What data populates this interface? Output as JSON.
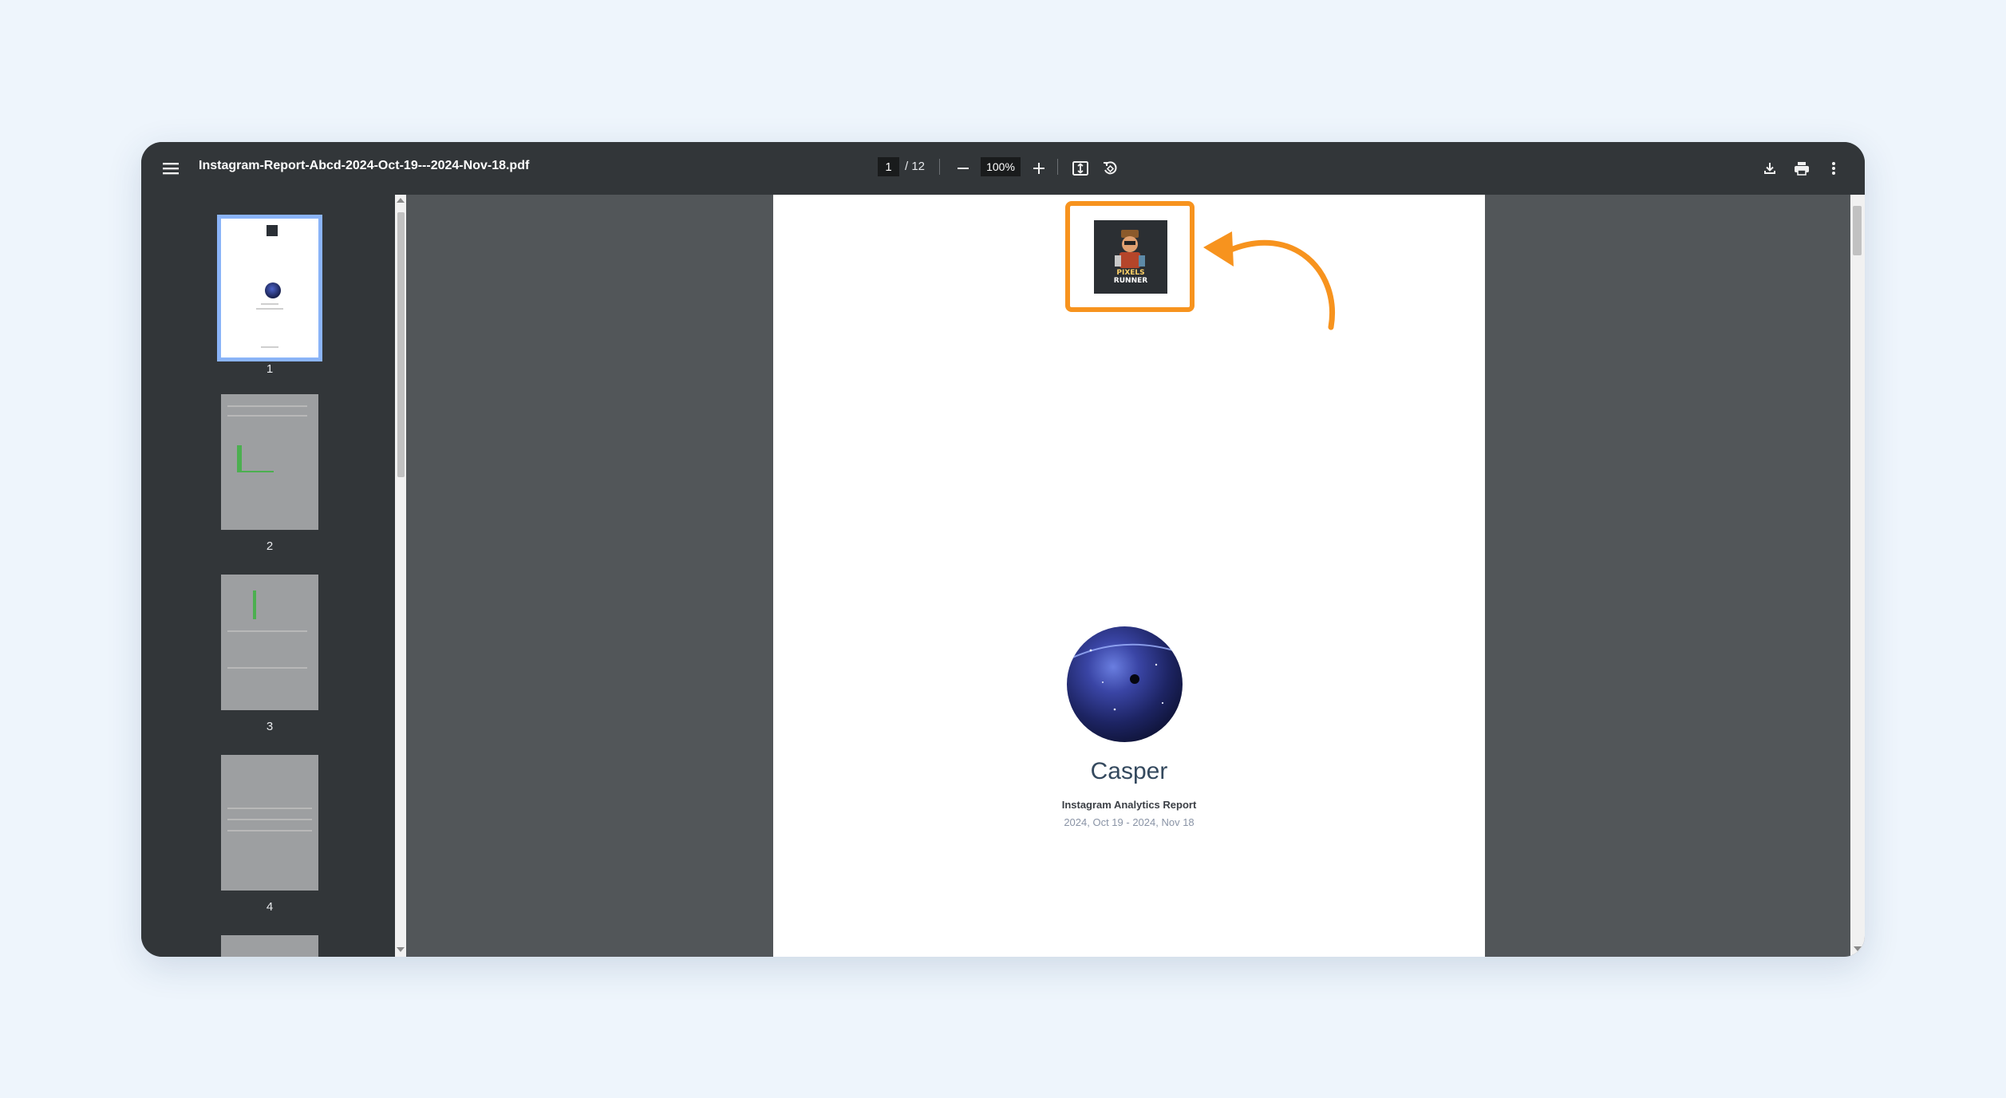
{
  "toolbar": {
    "menu_icon": "hamburger-menu-icon",
    "file_name": "Instagram-Report-Abcd-2024-Oct-19---2024-Nov-18.pdf",
    "current_page": "1",
    "total_pages": "/ 12",
    "zoom": "100%",
    "icons": [
      "minus-icon",
      "plus-icon",
      "fit-page-icon",
      "rotate-icon",
      "download-icon",
      "print-icon",
      "more-vertical-icon"
    ]
  },
  "sidebar": {
    "thumbnails": [
      {
        "label": "1",
        "active": true
      },
      {
        "label": "2",
        "active": false
      },
      {
        "label": "3",
        "active": false
      },
      {
        "label": "4",
        "active": false
      }
    ]
  },
  "document": {
    "name": "Casper",
    "subtitle": "Instagram Analytics Report",
    "date_range": "2024, Oct 19 - 2024, Nov 18",
    "logo_text": "PIXELS RUNNER"
  },
  "annotation": {
    "highlight_color": "#f7931e",
    "arrow_color": "#f7931e"
  }
}
